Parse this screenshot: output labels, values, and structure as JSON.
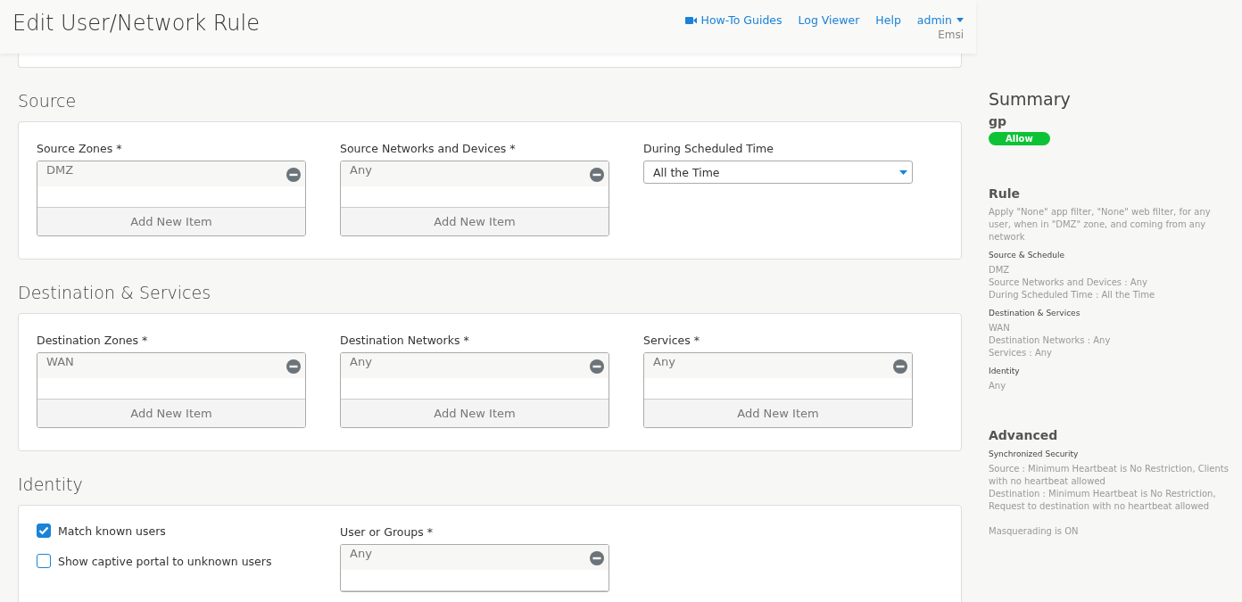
{
  "header": {
    "title": "Edit User/Network Rule",
    "links": [
      {
        "label": "How-To Guides"
      },
      {
        "label": "Log Viewer"
      },
      {
        "label": "Help"
      }
    ],
    "user": {
      "name": "admin",
      "org": "Emsi"
    }
  },
  "sections": [
    {
      "title": "Source",
      "fields": [
        {
          "kind": "list",
          "label": "Source Zones *",
          "items": [
            "DMZ"
          ],
          "add_label": "Add New Item"
        },
        {
          "kind": "list",
          "label": "Source Networks and Devices *",
          "items": [
            "Any"
          ],
          "add_label": "Add New Item"
        },
        {
          "kind": "select",
          "label": "During Scheduled Time",
          "value": "All the Time"
        }
      ]
    },
    {
      "title": "Destination & Services",
      "fields": [
        {
          "kind": "list",
          "label": "Destination Zones *",
          "items": [
            "WAN"
          ],
          "add_label": "Add New Item"
        },
        {
          "kind": "list",
          "label": "Destination Networks *",
          "items": [
            "Any"
          ],
          "add_label": "Add New Item"
        },
        {
          "kind": "list",
          "label": "Services *",
          "items": [
            "Any"
          ],
          "add_label": "Add New Item"
        }
      ]
    },
    {
      "title": "Identity",
      "checkboxes": [
        {
          "label": "Match known users",
          "checked": true
        },
        {
          "label": "Show captive portal to unknown users",
          "checked": false
        }
      ],
      "fields": [
        {
          "kind": "list",
          "label": "User or Groups *",
          "items": [
            "Any"
          ]
        }
      ]
    }
  ],
  "summary": {
    "title": "Summary",
    "name": "gp",
    "action": "Allow",
    "groups": [
      {
        "title": "Rule",
        "description": "Apply \"None\" app filter, \"None\" web filter, for any user, when in \"DMZ\" zone, and coming from any network",
        "subsections": [
          {
            "title": "Source & Schedule",
            "lines": [
              "DMZ",
              "Source Networks and Devices : Any",
              "During Scheduled Time : All the Time"
            ]
          },
          {
            "title": "Destination & Services",
            "lines": [
              "WAN",
              "Destination Networks : Any",
              "Services : Any"
            ]
          },
          {
            "title": "Identity",
            "lines": [
              "Any"
            ]
          }
        ]
      },
      {
        "title": "Advanced",
        "subsections": [
          {
            "title": "Synchronized Security",
            "lines": [
              "Source : Minimum Heartbeat is No Restriction, Clients with no heartbeat allowed",
              "Destination : Minimum Heartbeat is No Restriction, Request to destination with no heartbeat allowed"
            ]
          }
        ],
        "notes": [
          "Masquerading is ON"
        ]
      }
    ]
  }
}
